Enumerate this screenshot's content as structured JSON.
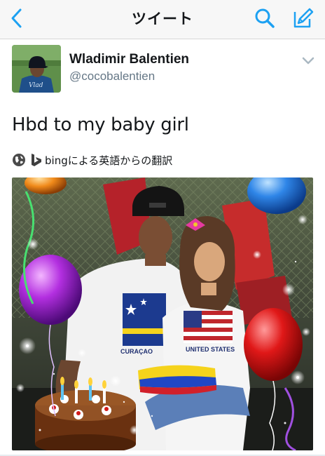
{
  "nav": {
    "title": "ツイート",
    "accent_color": "#1da1f2",
    "icons": [
      "back-chevron-icon",
      "search-icon",
      "compose-icon"
    ]
  },
  "tweet": {
    "author_name": "Wladimir Balentien",
    "author_handle": "@cocobalentien",
    "text": "Hbd to my baby girl",
    "translate_label": "bingによる英語からの翻訳",
    "icons": [
      "globe-icon",
      "bing-logo-icon",
      "caret-down-icon"
    ]
  },
  "photo": {
    "shirt_text_man": "CURAÇAO",
    "shirt_text_girl": "UNITED STATES"
  }
}
